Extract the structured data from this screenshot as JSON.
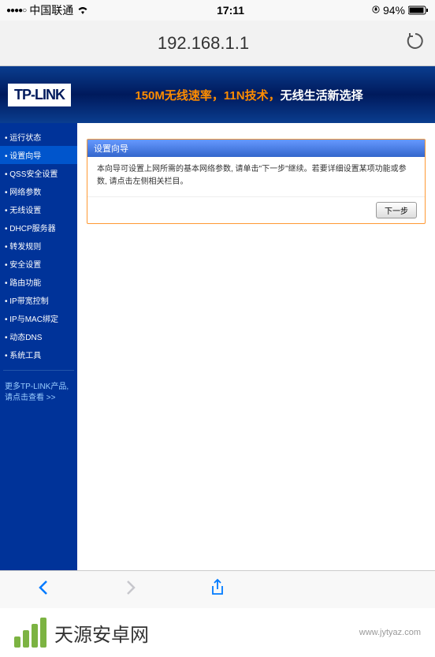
{
  "status_bar": {
    "signal_dots": "●●●●○",
    "carrier": "中国联通",
    "time": "17:11",
    "battery_pct": "94%"
  },
  "address_bar": {
    "url": "192.168.1.1"
  },
  "router_header": {
    "logo": "TP-LINK",
    "tagline_highlight": "150M无线速率，11N技术，",
    "tagline_rest": "无线生活新选择"
  },
  "sidebar": {
    "items": [
      "运行状态",
      "设置向导",
      "QSS安全设置",
      "网络参数",
      "无线设置",
      "DHCP服务器",
      "转发规则",
      "安全设置",
      "路由功能",
      "IP带宽控制",
      "IP与MAC绑定",
      "动态DNS",
      "系统工具"
    ],
    "footer_line1": "更多TP-LINK产品,",
    "footer_link": "请点击查看 >>"
  },
  "wizard": {
    "title": "设置向导",
    "body": "本向导可设置上网所需的基本网络参数, 请单击\"下一步\"继续。若要详细设置某项功能或参数, 请点击左侧相关栏目。",
    "next_label": "下一步"
  },
  "watermark": {
    "brand": "天源安卓网",
    "url": "www.jytyaz.com"
  }
}
